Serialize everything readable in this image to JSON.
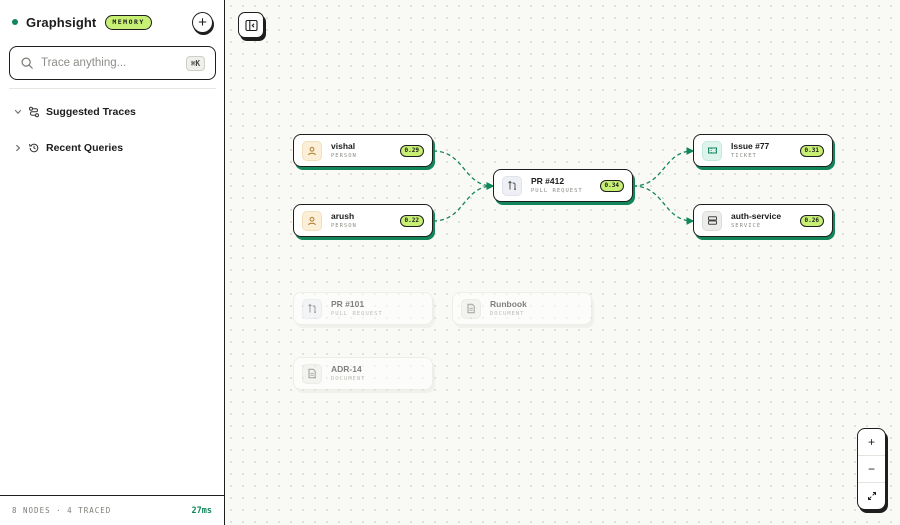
{
  "app": {
    "name": "Graphsight",
    "badge": "MEMORY",
    "new_button": "+"
  },
  "search": {
    "placeholder": "Trace anything...",
    "shortcut": "⌘K"
  },
  "sections": [
    {
      "label": "Suggested Traces",
      "expanded": true,
      "icon": "trace-icon"
    },
    {
      "label": "Recent Queries",
      "expanded": false,
      "icon": "history-icon"
    }
  ],
  "footer": {
    "stats": "8 NODES · 4 TRACED",
    "latency": "27ms"
  },
  "nodes": [
    {
      "title": "vishal",
      "type": "PERSON",
      "score": "0.29",
      "icon": "person-icon",
      "traced": true
    },
    {
      "title": "arush",
      "type": "PERSON",
      "score": "0.22",
      "icon": "person-icon",
      "traced": true
    },
    {
      "title": "PR #412",
      "type": "PULL REQUEST",
      "score": "0.34",
      "icon": "pull-request-icon",
      "traced": true
    },
    {
      "title": "Issue #77",
      "type": "TICKET",
      "score": "0.31",
      "icon": "ticket-icon",
      "traced": true
    },
    {
      "title": "auth-service",
      "type": "SERVICE",
      "score": "0.26",
      "icon": "service-icon",
      "traced": true
    },
    {
      "title": "PR #101",
      "type": "PULL REQUEST",
      "icon": "pull-request-icon",
      "traced": false
    },
    {
      "title": "Runbook",
      "type": "DOCUMENT",
      "icon": "document-icon",
      "traced": false
    },
    {
      "title": "ADR-14",
      "type": "DOCUMENT",
      "icon": "document-icon",
      "traced": false
    }
  ],
  "zoom": {
    "in": "+",
    "out": "−"
  },
  "colors": {
    "accent": "#12855a",
    "badge": "#c6ef74",
    "ink": "#1e1e1e"
  }
}
